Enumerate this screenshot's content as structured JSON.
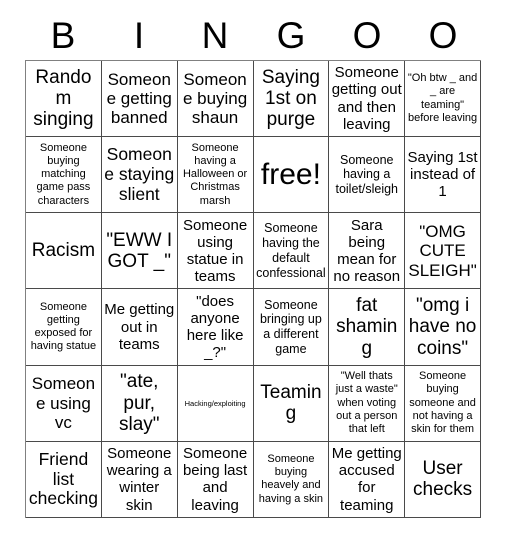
{
  "header": {
    "letters": [
      "B",
      "I",
      "N",
      "G",
      "O",
      "O"
    ]
  },
  "grid": {
    "rows": 6,
    "columns": 6,
    "cells": [
      {
        "text": "Random singing",
        "size": "xl"
      },
      {
        "text": "Someone getting banned",
        "size": "lg"
      },
      {
        "text": "Someone buying shaun",
        "size": "lg"
      },
      {
        "text": "Saying 1st on purge",
        "size": "xl"
      },
      {
        "text": "Someone getting out and then leaving",
        "size": "md"
      },
      {
        "text": "\"Oh btw _ and _ are teaming\" before leaving",
        "size": "xs"
      },
      {
        "text": "Someone buying matching game pass characters",
        "size": "xs"
      },
      {
        "text": "Someone staying slient",
        "size": "xl"
      },
      {
        "text": "Someone having a Halloween or Christmas marsh",
        "size": "xs"
      },
      {
        "text": "free!",
        "size": "xxl"
      },
      {
        "text": "Someone having a toilet/sleigh",
        "size": "sm"
      },
      {
        "text": "Saying 1st instead of 1",
        "size": "md"
      },
      {
        "text": "Racism",
        "size": "xl"
      },
      {
        "text": "\"EWW I GOT _\"",
        "size": "xl"
      },
      {
        "text": "Someone using statue in teams",
        "size": "md"
      },
      {
        "text": "Someone having the default confessional",
        "size": "sm"
      },
      {
        "text": "Sara being mean for no reason",
        "size": "md"
      },
      {
        "text": "\"OMG CUTE SLEIGH\"",
        "size": "lg"
      },
      {
        "text": "Someone getting exposed for having statue",
        "size": "xs"
      },
      {
        "text": "Me getting out in teams",
        "size": "md"
      },
      {
        "text": "\"does anyone here like _?\"",
        "size": "md"
      },
      {
        "text": "Someone bringing up a different game",
        "size": "sm"
      },
      {
        "text": "fat shaming",
        "size": "xl"
      },
      {
        "text": "\"omg i have no coins\"",
        "size": "xl"
      },
      {
        "text": "Someone using vc",
        "size": "lg"
      },
      {
        "text": "\"ate, pur, slay\"",
        "size": "xl"
      },
      {
        "text": "Hacking/exploiting",
        "size": "tiny"
      },
      {
        "text": "Teaming",
        "size": "xl"
      },
      {
        "text": "\"Well thats just a waste\" when voting out a person that left",
        "size": "xs"
      },
      {
        "text": "Someone buying someone and not having a skin for them",
        "size": "xs"
      },
      {
        "text": "Friend list checking",
        "size": "xl"
      },
      {
        "text": "Someone wearing a winter skin",
        "size": "md"
      },
      {
        "text": "Someone being last and leaving",
        "size": "md"
      },
      {
        "text": "Someone buying heavely and having a skin",
        "size": "xs"
      },
      {
        "text": "Me getting accused for teaming",
        "size": "md"
      },
      {
        "text": "User checks",
        "size": "xl"
      }
    ]
  },
  "colors": {
    "background": "#ffffff",
    "text": "#000000",
    "grid_border": "#4a4a4a",
    "outer_border": "#808080"
  }
}
